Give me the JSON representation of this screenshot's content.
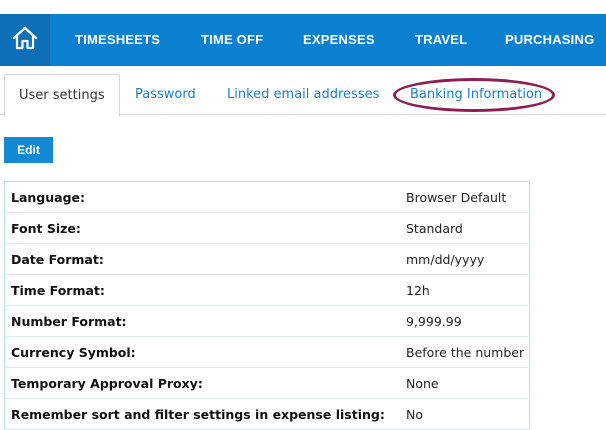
{
  "nav": {
    "home_icon": "home-icon",
    "items": [
      "TIMESHEETS",
      "TIME OFF",
      "EXPENSES",
      "TRAVEL",
      "PURCHASING"
    ]
  },
  "tabs": [
    {
      "label": "User settings",
      "active": true
    },
    {
      "label": "Password",
      "active": false
    },
    {
      "label": "Linked email addresses",
      "active": false
    },
    {
      "label": "Banking Information",
      "active": false
    }
  ],
  "actions": {
    "edit_label": "Edit"
  },
  "settings": [
    {
      "label": "Language:",
      "value": "Browser Default"
    },
    {
      "label": "Font Size:",
      "value": "Standard"
    },
    {
      "label": "Date Format:",
      "value": "mm/dd/yyyy"
    },
    {
      "label": "Time Format:",
      "value": "12h"
    },
    {
      "label": "Number Format:",
      "value": "9,999.99"
    },
    {
      "label": "Currency Symbol:",
      "value": "Before the number"
    },
    {
      "label": "Temporary Approval Proxy:",
      "value": "None"
    },
    {
      "label": "Remember sort and filter settings in expense listing:",
      "value": "No"
    }
  ],
  "colors": {
    "brand": "#0b7fd0",
    "annotation": "#8e1f4e"
  }
}
